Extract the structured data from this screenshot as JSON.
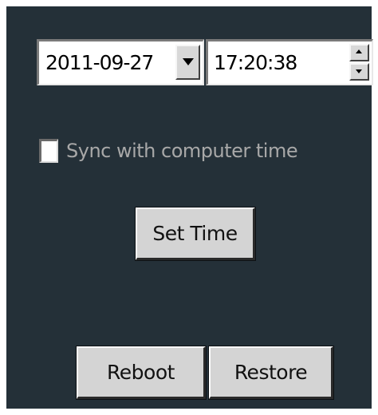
{
  "datetime": {
    "date_value": "2011-09-27",
    "time_value": "17:20:38"
  },
  "sync": {
    "label": "Sync with computer time",
    "checked": false
  },
  "buttons": {
    "set_time": "Set Time",
    "reboot": "Reboot",
    "restore": "Restore"
  },
  "colors": {
    "panel_background": "#243038",
    "button_face": "#d4d4d4",
    "label_text": "#a8a8a8"
  },
  "icons": {
    "dropdown": "chevron-down-icon",
    "spin_up": "spin-up-arrow-icon",
    "spin_down": "spin-down-arrow-icon"
  }
}
